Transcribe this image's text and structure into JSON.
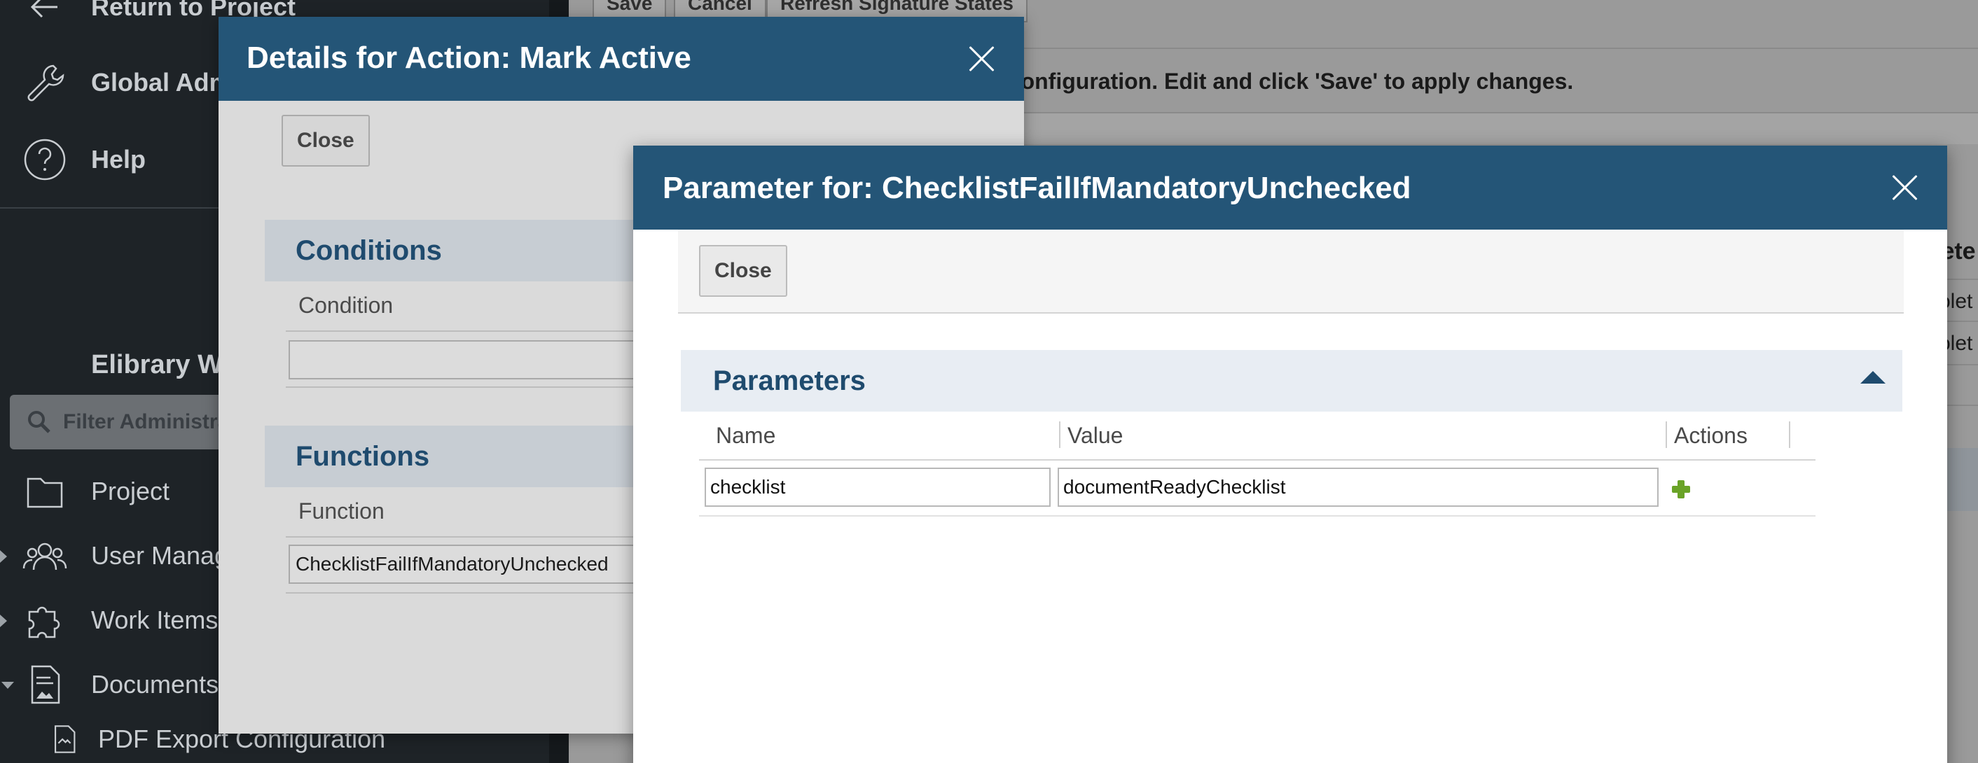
{
  "sidebar": {
    "return_label": "Return to Project",
    "global_admin_label": "Global Administration",
    "help_label": "Help",
    "heading": "Elibrary Workspace",
    "filter_placeholder": "Filter Administration",
    "items": [
      {
        "label": "Project",
        "icon": "folder-icon"
      },
      {
        "label": "User Management",
        "icon": "users-icon"
      },
      {
        "label": "Work Items",
        "icon": "puzzle-icon"
      },
      {
        "label": "Documents & Pages",
        "icon": "document-icon"
      },
      {
        "label": "PDF Export Configuration",
        "icon": "pdf-doc-icon"
      }
    ]
  },
  "main": {
    "toolbar": {
      "save_label": "Save",
      "cancel_label": "Cancel",
      "refresh_label": "Refresh Signature States"
    },
    "notice": "l configuration. Edit and click 'Save' to apply changes.",
    "partial_header": "lete",
    "partial_cells": [
      "olet",
      "olet"
    ]
  },
  "dialog_action": {
    "title": "Details for Action: Mark Active",
    "close_label": "Close",
    "conditions": {
      "title": "Conditions",
      "column": "Condition",
      "value": ""
    },
    "functions": {
      "title": "Functions",
      "column": "Function",
      "value": "ChecklistFailIfMandatoryUnchecked"
    }
  },
  "dialog_parameter": {
    "title": "Parameter for: ChecklistFailIfMandatoryUnchecked",
    "close_label": "Close",
    "section_title": "Parameters",
    "columns": {
      "name": "Name",
      "value": "Value",
      "actions": "Actions"
    },
    "rows": [
      {
        "name": "checklist",
        "value": "documentReadyChecklist"
      }
    ]
  },
  "colors": {
    "header_blue": "#245577",
    "section_text": "#1f4b6e",
    "add_green": "#6aa327"
  }
}
